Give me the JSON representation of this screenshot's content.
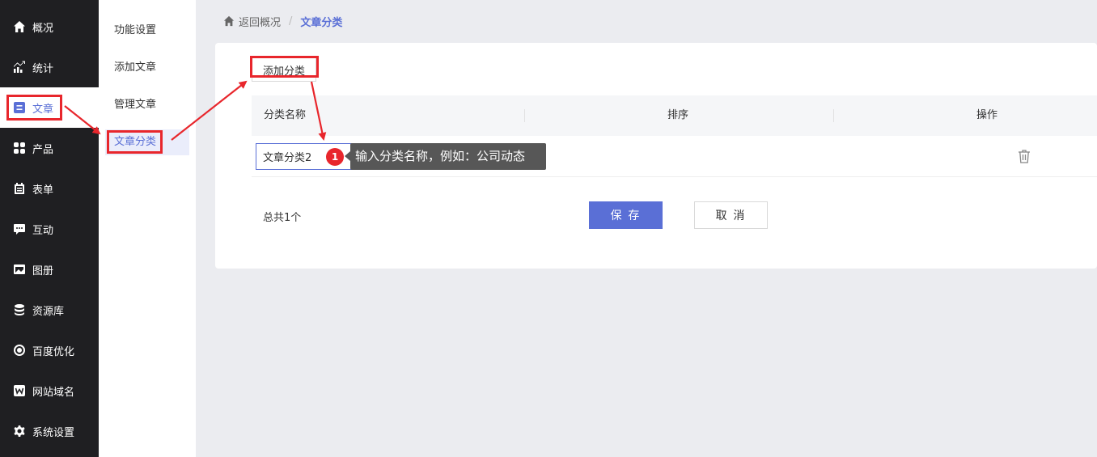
{
  "nav": {
    "items": [
      {
        "label": "概况",
        "icon": "home-icon"
      },
      {
        "label": "统计",
        "icon": "chart-icon"
      },
      {
        "label": "文章",
        "icon": "article-icon",
        "active": true
      },
      {
        "label": "产品",
        "icon": "grid-icon"
      },
      {
        "label": "表单",
        "icon": "form-icon"
      },
      {
        "label": "互动",
        "icon": "chat-icon"
      },
      {
        "label": "图册",
        "icon": "album-icon"
      },
      {
        "label": "资源库",
        "icon": "database-icon"
      },
      {
        "label": "百度优化",
        "icon": "seo-icon"
      },
      {
        "label": "网站域名",
        "icon": "domain-icon"
      },
      {
        "label": "系统设置",
        "icon": "gear-icon"
      }
    ]
  },
  "subnav": {
    "items": [
      {
        "label": "功能设置"
      },
      {
        "label": "添加文章"
      },
      {
        "label": "管理文章"
      },
      {
        "label": "文章分类",
        "active": true
      }
    ]
  },
  "breadcrumb": {
    "back": "返回概况",
    "separator": "/",
    "current": "文章分类"
  },
  "toolbar": {
    "add_label": "添加分类"
  },
  "table": {
    "headers": [
      "分类名称",
      "排序",
      "操作"
    ],
    "rows": [
      {
        "name_value": "文章分类2"
      }
    ]
  },
  "footer": {
    "total": "总共1个",
    "save": "保 存",
    "cancel": "取 消"
  },
  "annotation": {
    "step": "1",
    "tip": "输入分类名称，例如：公司动态"
  },
  "colors": {
    "accent": "#5a6fd6",
    "nav_bg": "#1f1f22",
    "annotation_red": "#e8262c"
  }
}
